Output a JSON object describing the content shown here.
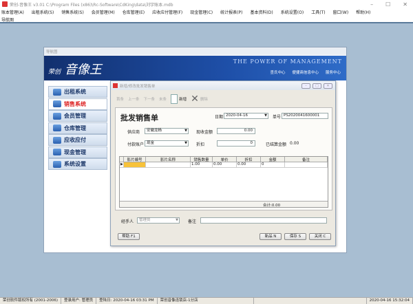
{
  "window": {
    "title": "荣创-音像王 v3.01 C:\\Program Files (x86)\\Rc-Software\\CdKing\\data\\刘宇账本.mdb"
  },
  "menu": [
    "账本管理(A)",
    "出租系统(S)",
    "销售系统(S)",
    "会员管理(M)",
    "仓库管理(E)",
    "应收应付管理(F)",
    "现金管理(C)",
    "统计报表(P)",
    "基本资料(D)",
    "系统设置(O)",
    "工具(T)",
    "窗口(W)",
    "帮助(H)"
  ],
  "menu2": "导航图",
  "nav": {
    "title": "导航图",
    "brand_small": "荣创",
    "brand": "音像王",
    "slogan": "THE POWER OF MANAGEMENT",
    "links": [
      "查氏中心",
      "便捷商信息中心",
      "服务中心"
    ],
    "items": [
      "出租系统",
      "销售系统",
      "会员管理",
      "仓库管理",
      "应收应付",
      "现金管理",
      "系统设置"
    ]
  },
  "dialog": {
    "title": "新增/修改批发销售单",
    "toolbar": [
      "首条",
      "上一条",
      "下一条",
      "末条",
      "新增",
      "删除"
    ],
    "heading": "批发销售单",
    "date_label": "日期",
    "date": "2020-04-16",
    "no_label": "单号",
    "no": "PS2020041600001",
    "supplier_label": "供应商",
    "supplier": "安徽龙杨",
    "paid_label": "现收金额",
    "paid": "0.00",
    "account_label": "付款账户",
    "account": "现金",
    "discount_label": "折扣",
    "discount": "0",
    "settled_label": "已结算金额",
    "settled": "0.00",
    "columns": [
      "影片编号",
      "影片名称",
      "销售数量",
      "单价",
      "折扣",
      "金额",
      "备注"
    ],
    "rows": [
      [
        "",
        "",
        "1.00",
        "0.00",
        "0.00",
        "0",
        ""
      ]
    ],
    "total": "合计:0.00",
    "handler_label": "经手人",
    "handler": "管理员",
    "remark_label": "备注",
    "remark": "",
    "buttons": {
      "help": "帮助 F1",
      "new": "新品 N",
      "save": "保存 S",
      "close": "关闭 C"
    }
  },
  "status": [
    "荣创软件版权所有 (2001-2006)",
    "登录用户: 管理员",
    "登陆日: 2020-04-16 03:31 PM",
    "荣创音像连锁店-1分店",
    "2020-04-16 15:32:04"
  ]
}
